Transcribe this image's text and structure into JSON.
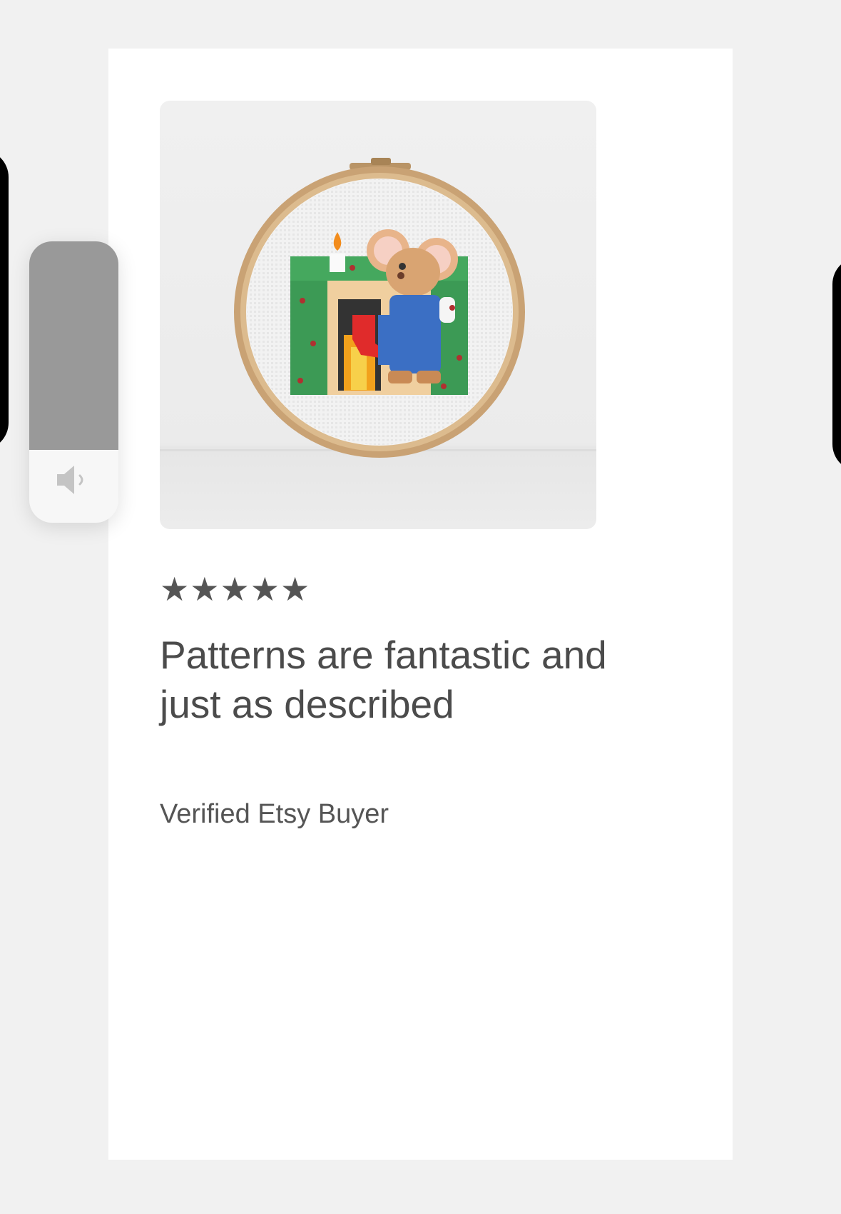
{
  "review": {
    "image_alt": "cross-stitch hoop: mouse hanging stocking by fireplace",
    "rating": 5,
    "stars_text": "★★★★★",
    "title": "Patterns are fantastic and just as described",
    "reviewer": "Verified Etsy Buyer"
  },
  "volume_hud": {
    "level": 0.74,
    "icon": "speaker-icon"
  },
  "colors": {
    "background": "#f1f1f1",
    "card": "#ffffff",
    "text": "#4b4b4b",
    "stars": "#555555",
    "volume_fill": "#999999"
  }
}
